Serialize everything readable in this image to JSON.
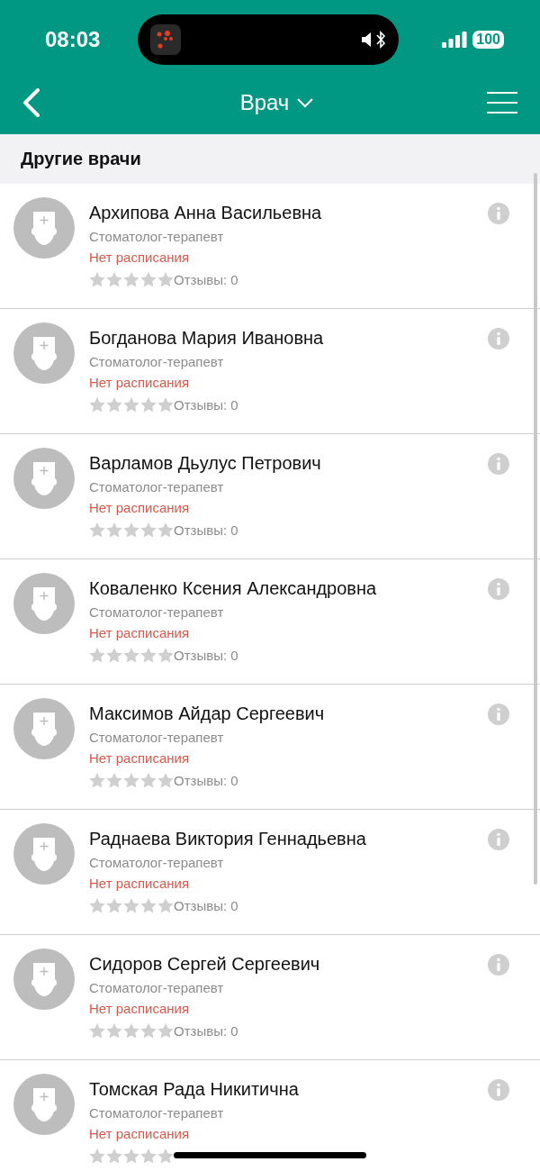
{
  "status_bar": {
    "time": "08:03",
    "battery": "100"
  },
  "header": {
    "title": "Врач"
  },
  "section": {
    "title": "Другие врачи"
  },
  "doctors": [
    {
      "name": "Архипова Анна Васильевна",
      "specialty": "Стоматолог-терапевт",
      "schedule": "Нет расписания",
      "stars": 0,
      "reviews": "Отзывы: 0"
    },
    {
      "name": "Богданова Мария Ивановна",
      "specialty": "Стоматолог-терапевт",
      "schedule": "Нет расписания",
      "stars": 0,
      "reviews": "Отзывы: 0"
    },
    {
      "name": "Варламов Дьулус Петрович",
      "specialty": "Стоматолог-терапевт",
      "schedule": "Нет расписания",
      "stars": 0,
      "reviews": "Отзывы: 0"
    },
    {
      "name": "Коваленко Ксения Александровна",
      "specialty": "Стоматолог-терапевт",
      "schedule": "Нет расписания",
      "stars": 0,
      "reviews": "Отзывы: 0"
    },
    {
      "name": "Максимов Айдар Сергеевич",
      "specialty": "Стоматолог-терапевт",
      "schedule": "Нет расписания",
      "stars": 0,
      "reviews": "Отзывы: 0"
    },
    {
      "name": "Раднаева Виктория Геннадьевна",
      "specialty": "Стоматолог-терапевт",
      "schedule": "Нет расписания",
      "stars": 0,
      "reviews": "Отзывы: 0"
    },
    {
      "name": "Сидоров Сергей Сергеевич",
      "specialty": "Стоматолог-терапевт",
      "schedule": "Нет расписания",
      "stars": 0,
      "reviews": "Отзывы: 0"
    },
    {
      "name": "Томская Рада Никитична",
      "specialty": "Стоматолог-терапевт",
      "schedule": "Нет расписания",
      "stars": 0
    }
  ]
}
